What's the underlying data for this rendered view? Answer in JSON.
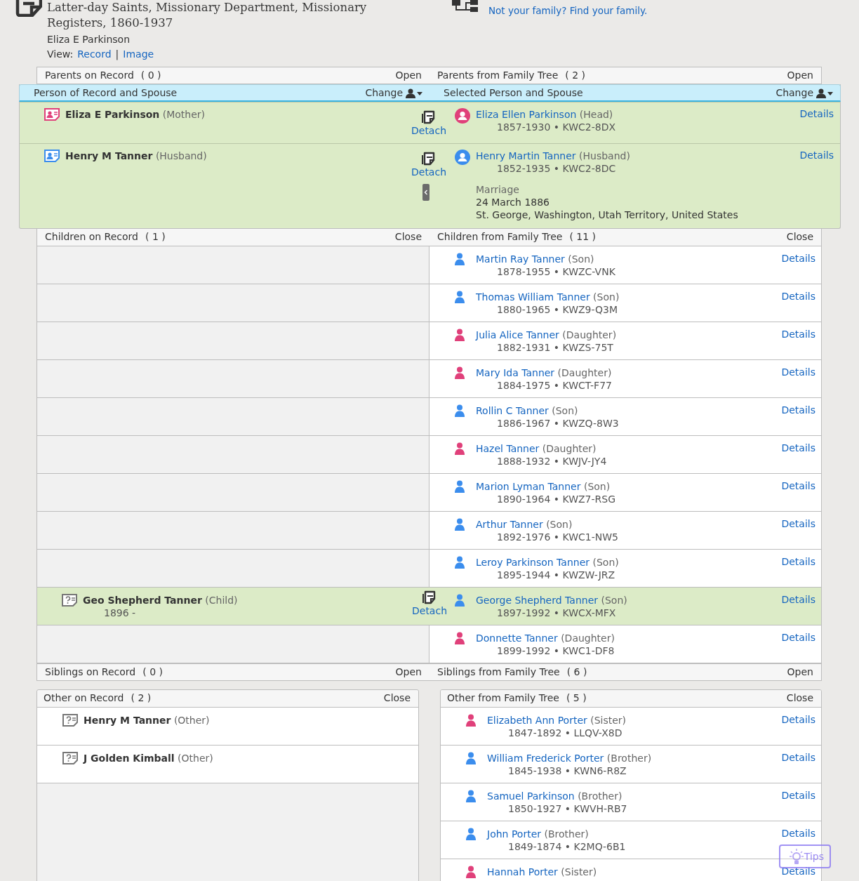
{
  "record_header": {
    "title": "Latter-day Saints, Missionary Department, Missionary Registers, 1860-1937",
    "person": "Eliza E Parkinson",
    "view_label": "View:",
    "view_links": [
      "Record",
      "Image"
    ],
    "separator": "|"
  },
  "family_link": "Not your family? Find your family.",
  "parents": {
    "record_title": "Parents on Record",
    "record_count": "( 0 )",
    "record_action": "Open",
    "tree_title": "Parents from Family Tree",
    "tree_count": "( 2 )",
    "tree_action": "Open"
  },
  "couple": {
    "record_title": "Person of Record and Spouse",
    "record_action": "Change",
    "tree_title": "Selected Person and Spouse",
    "tree_action": "Change",
    "rows": [
      {
        "record": {
          "name": "Eliza E Parkinson",
          "role": "(Mother)",
          "kind": "female"
        },
        "detach": "Detach",
        "tree": {
          "name": "Eliza Ellen Parkinson",
          "role": "(Head)",
          "life": "1857-1930 • KWC2-8DX",
          "kind": "female",
          "details": "Details"
        }
      },
      {
        "record": {
          "name": "Henry M Tanner",
          "role": "(Husband)",
          "kind": "male"
        },
        "detach": "Detach",
        "tree": {
          "name": "Henry Martin Tanner",
          "role": "(Husband)",
          "life": "1852-1935 • KWC2-8DC",
          "kind": "male",
          "details": "Details"
        },
        "marriage": {
          "label": "Marriage",
          "date": "24 March 1886",
          "place": "St. George, Washington, Utah Territory, United States"
        }
      }
    ]
  },
  "children": {
    "record_title": "Children on Record",
    "record_count": "( 1 )",
    "record_action": "Close",
    "tree_title": "Children from Family Tree",
    "tree_count": "( 11 )",
    "tree_action": "Close",
    "rows": [
      {
        "attached": false,
        "tree": {
          "name": "Martin Ray Tanner",
          "role": "(Son)",
          "life": "1878-1955 • KWZC-VNK",
          "kind": "male",
          "details": "Details"
        }
      },
      {
        "attached": false,
        "tree": {
          "name": "Thomas William Tanner",
          "role": "(Son)",
          "life": "1880-1965 • KWZ9-Q3M",
          "kind": "male",
          "details": "Details"
        }
      },
      {
        "attached": false,
        "tree": {
          "name": "Julia Alice Tanner",
          "role": "(Daughter)",
          "life": "1882-1931 • KWZS-75T",
          "kind": "female",
          "details": "Details"
        }
      },
      {
        "attached": false,
        "tree": {
          "name": "Mary Ida Tanner",
          "role": "(Daughter)",
          "life": "1884-1975 • KWCT-F77",
          "kind": "female",
          "details": "Details"
        }
      },
      {
        "attached": false,
        "tree": {
          "name": "Rollin C Tanner",
          "role": "(Son)",
          "life": "1886-1967 • KWZQ-8W3",
          "kind": "male",
          "details": "Details"
        }
      },
      {
        "attached": false,
        "tree": {
          "name": "Hazel Tanner",
          "role": "(Daughter)",
          "life": "1888-1932 • KWJV-JY4",
          "kind": "female",
          "details": "Details"
        }
      },
      {
        "attached": false,
        "tree": {
          "name": "Marion Lyman Tanner",
          "role": "(Son)",
          "life": "1890-1964 • KWZ7-RSG",
          "kind": "male",
          "details": "Details"
        }
      },
      {
        "attached": false,
        "tree": {
          "name": "Arthur Tanner",
          "role": "(Son)",
          "life": "1892-1976 • KWC1-NW5",
          "kind": "male",
          "details": "Details"
        }
      },
      {
        "attached": false,
        "tree": {
          "name": "Leroy Parkinson Tanner",
          "role": "(Son)",
          "life": "1895-1944 • KWZW-JRZ",
          "kind": "male",
          "details": "Details"
        }
      },
      {
        "attached": true,
        "record": {
          "name": "Geo Shepherd Tanner",
          "role": "(Child)",
          "life": "1896 -",
          "kind": "unknown"
        },
        "detach": "Detach",
        "tree": {
          "name": "George Shepherd Tanner",
          "role": "(Son)",
          "life": "1897-1992 • KWCX-MFX",
          "kind": "male",
          "details": "Details"
        }
      },
      {
        "attached": false,
        "tree": {
          "name": "Donnette Tanner",
          "role": "(Daughter)",
          "life": "1899-1992 • KWC1-DF8",
          "kind": "female",
          "details": "Details"
        }
      }
    ]
  },
  "siblings": {
    "record_title": "Siblings on Record",
    "record_count": "( 0 )",
    "record_action": "Open",
    "tree_title": "Siblings from Family Tree",
    "tree_count": "( 6 )",
    "tree_action": "Open"
  },
  "other": {
    "record": {
      "title": "Other on Record",
      "count": "( 2 )",
      "action": "Close",
      "rows": [
        {
          "name": "Henry M Tanner",
          "role": "(Other)",
          "kind": "unknown"
        },
        {
          "name": "J Golden Kimball",
          "role": "(Other)",
          "kind": "unknown"
        }
      ]
    },
    "tree": {
      "title": "Other from Family Tree",
      "count": "( 5 )",
      "action": "Close",
      "rows": [
        {
          "name": "Elizabeth Ann Porter",
          "role": "(Sister)",
          "life": "1847-1892 • LLQV-X8D",
          "kind": "female",
          "details": "Details"
        },
        {
          "name": "William Frederick Porter",
          "role": "(Brother)",
          "life": "1845-1938 • KWN6-R8Z",
          "kind": "male",
          "details": "Details"
        },
        {
          "name": "Samuel Parkinson",
          "role": "(Brother)",
          "life": "1850-1927 • KWVH-RB7",
          "kind": "male",
          "details": "Details"
        },
        {
          "name": "John Porter",
          "role": "(Brother)",
          "life": "1849-1874 • K2MQ-6B1",
          "kind": "male",
          "details": "Details"
        },
        {
          "name": "Hannah Porter",
          "role": "(Sister)",
          "kind": "female",
          "details": "Details"
        }
      ]
    }
  },
  "tips": "Tips"
}
